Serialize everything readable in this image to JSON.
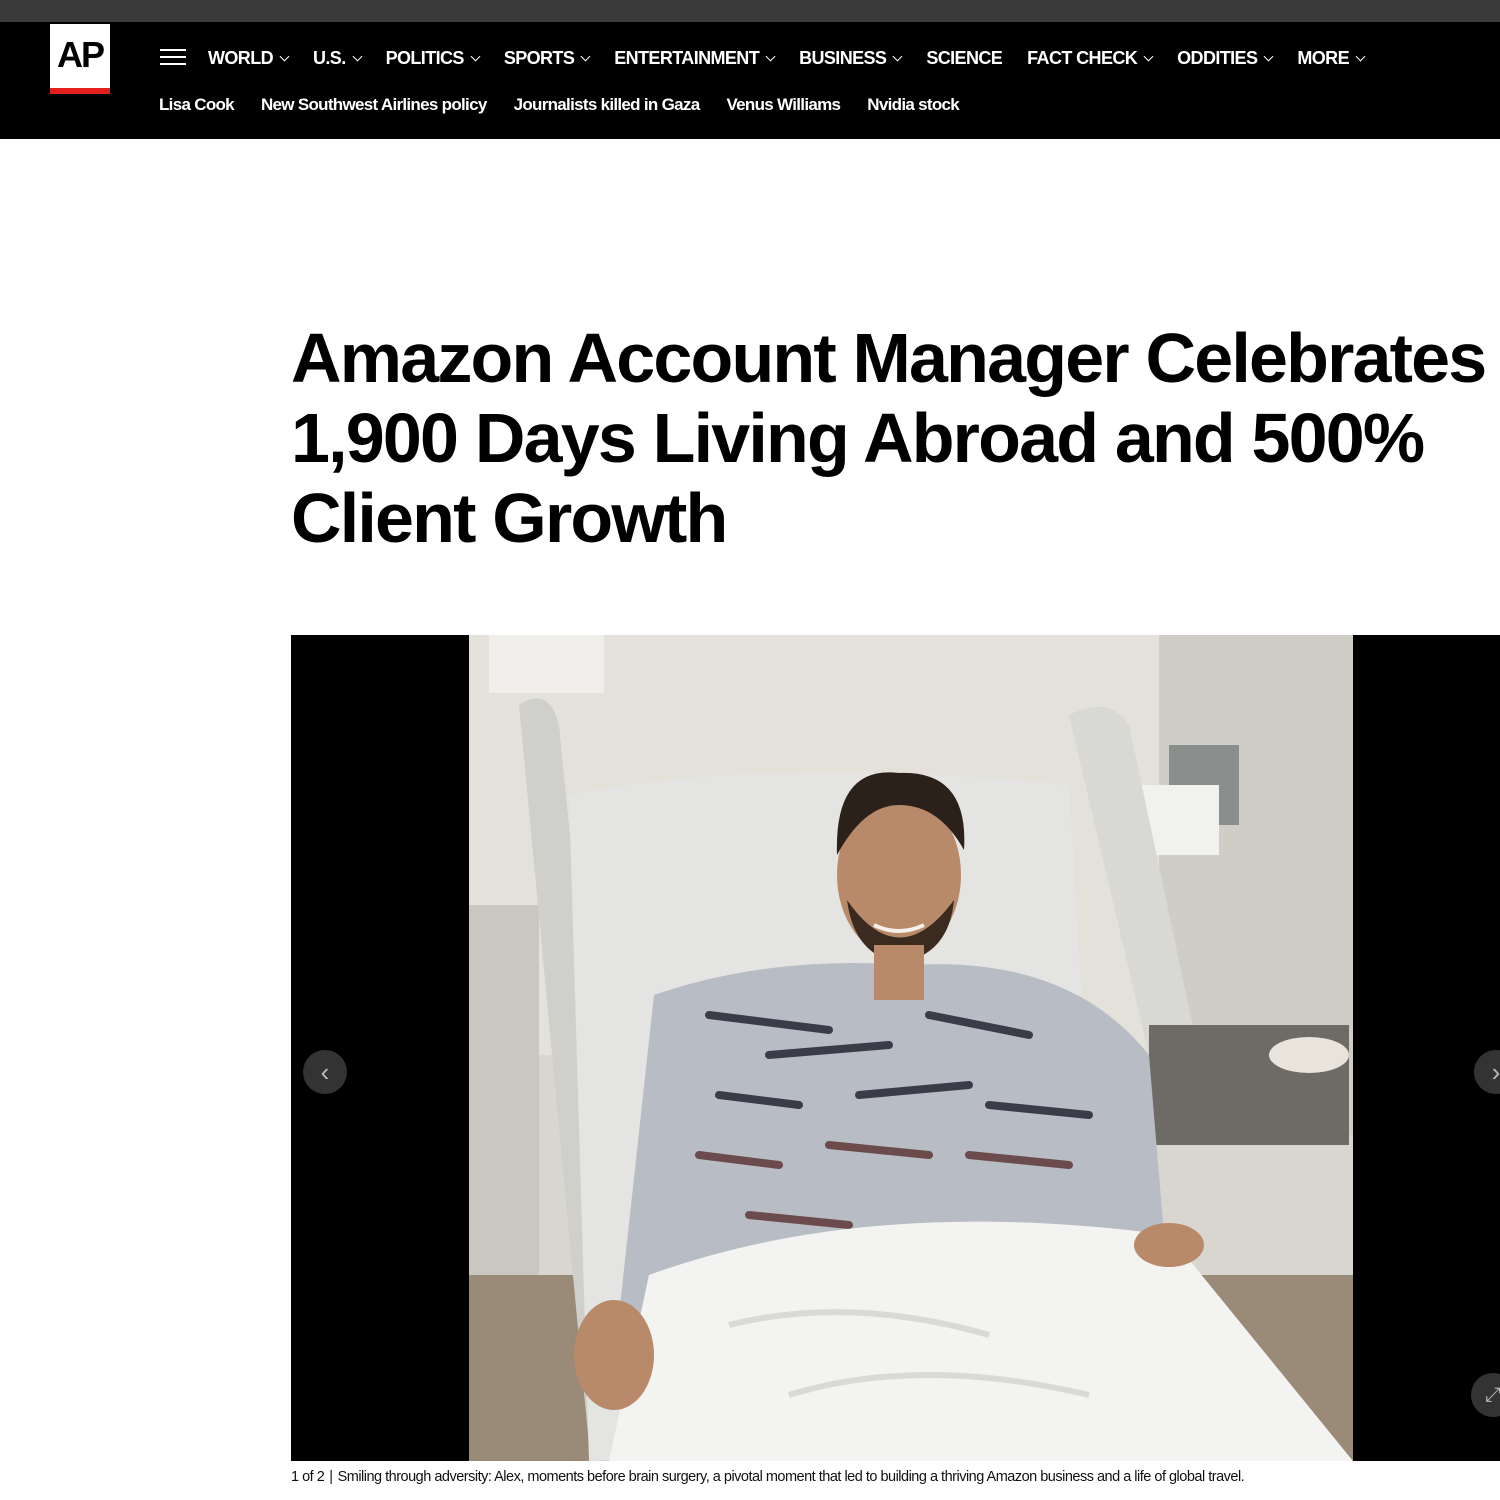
{
  "brand": {
    "logo_text": "AP"
  },
  "nav": {
    "items": [
      {
        "label": "WORLD",
        "has_dropdown": true
      },
      {
        "label": "U.S.",
        "has_dropdown": true
      },
      {
        "label": "POLITICS",
        "has_dropdown": true
      },
      {
        "label": "SPORTS",
        "has_dropdown": true
      },
      {
        "label": "ENTERTAINMENT",
        "has_dropdown": true
      },
      {
        "label": "BUSINESS",
        "has_dropdown": true
      },
      {
        "label": "SCIENCE",
        "has_dropdown": false
      },
      {
        "label": "FACT CHECK",
        "has_dropdown": true
      },
      {
        "label": "ODDITIES",
        "has_dropdown": true
      },
      {
        "label": "MORE",
        "has_dropdown": true
      }
    ]
  },
  "trending": [
    "Lisa Cook",
    "New Southwest Airlines policy",
    "Journalists killed in Gaza",
    "Venus Williams",
    "Nvidia stock"
  ],
  "article": {
    "headline": "Amazon Account Manager Celebrates 1,900 Days Living Abroad and 500% Client Growth"
  },
  "gallery": {
    "counter": "1 of 2",
    "separator": "|",
    "caption": "Smiling through adversity: Alex, moments before brain surgery, a pivotal moment that led to building a thriving Amazon business and a life of global travel.",
    "prev_icon": "chevron-left-icon",
    "next_icon": "chevron-right-icon",
    "expand_icon": "expand-icon"
  },
  "colors": {
    "header_bg": "#000000",
    "logo_accent": "#e3211c"
  }
}
